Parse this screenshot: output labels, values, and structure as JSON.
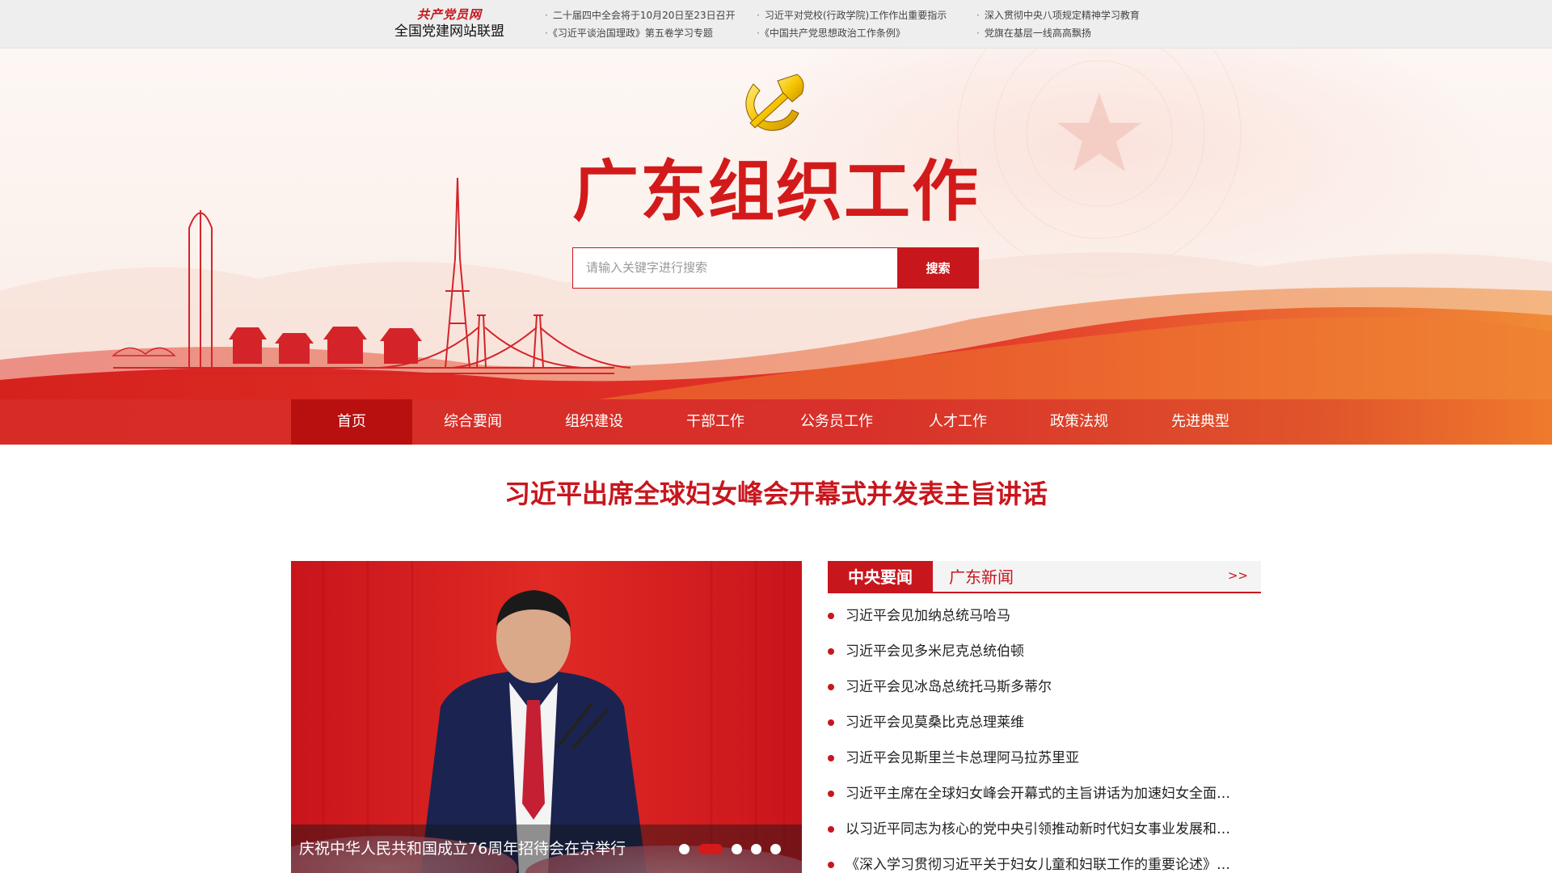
{
  "union": {
    "brand": "共产党员网",
    "name": "全国党建网站联盟"
  },
  "top_links": [
    "二十届四中全会将于10月20日至23日召开",
    "习近平对党校(行政学院)工作作出重要指示",
    "深入贯彻中央八项规定精神学习教育",
    "《习近平谈治国理政》第五卷学习专题",
    "《中国共产党思想政治工作条例》",
    "党旗在基层一线高高飘扬"
  ],
  "banner": {
    "title": "广东组织工作"
  },
  "search": {
    "placeholder": "请输入关键字进行搜索",
    "button_label": "搜索"
  },
  "nav": {
    "items": [
      "首页",
      "综合要闻",
      "组织建设",
      "干部工作",
      "公务员工作",
      "人才工作",
      "政策法规",
      "先进典型"
    ],
    "active_index": 0
  },
  "headline": "习近平出席全球妇女峰会开幕式并发表主旨讲话",
  "carousel": {
    "caption": "庆祝中华人民共和国成立76周年招待会在京举行",
    "slide_count": 5,
    "active_slide": 1
  },
  "news": {
    "tabs": [
      "中央要闻",
      "广东新闻"
    ],
    "active_tab": 0,
    "more_label": ">>",
    "items": [
      "习近平会见加纳总统马哈马",
      "习近平会见多米尼克总统伯顿",
      "习近平会见冰岛总统托马斯多蒂尔",
      "习近平会见莫桑比克总理莱维",
      "习近平会见斯里兰卡总理阿马拉苏里亚",
      "习近平主席在全球妇女峰会开幕式的主旨讲话为加速妇女全面…",
      "以习近平同志为核心的党中央引领推动新时代妇女事业发展和…",
      "《深入学习贯彻习近平关于妇女儿童和妇联工作的重要论述》…"
    ]
  },
  "colors": {
    "primary_red": "#c8161d",
    "nav_orange": "#ef7a2c",
    "gold": "#f5c400"
  }
}
